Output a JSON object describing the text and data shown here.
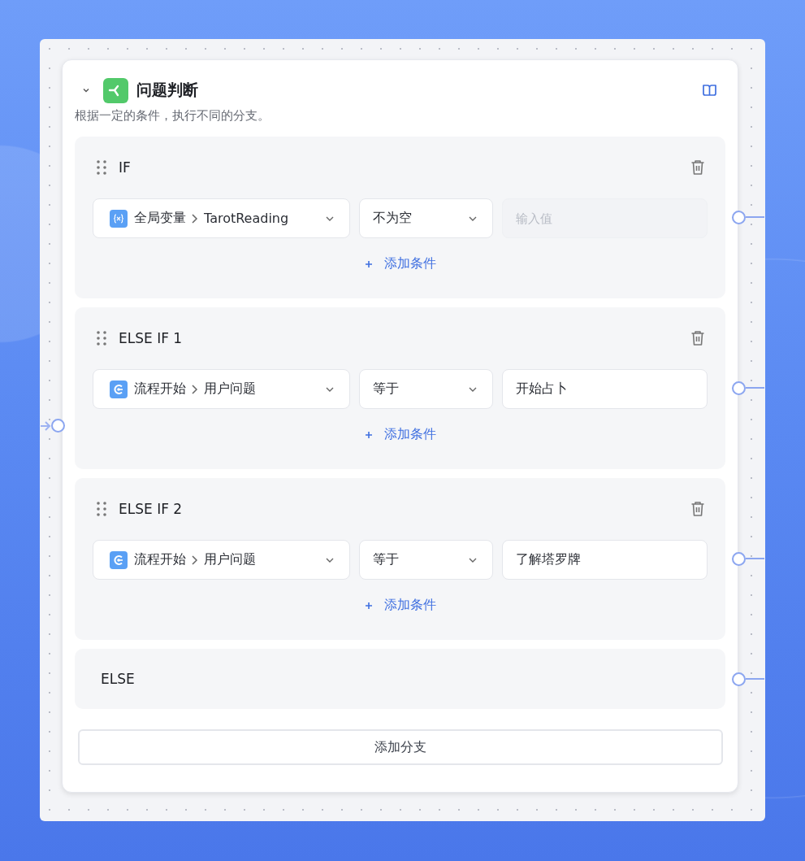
{
  "node": {
    "title": "问题判断",
    "expanded": true,
    "description": "根据一定的条件，执行不同的分支。"
  },
  "branches": [
    {
      "kind": "condition",
      "label": "IF",
      "conditions": [
        {
          "kind": "variable",
          "source": "全局变量",
          "field": "TarotReading",
          "operator": "不为空",
          "placeholder": "输入值"
        }
      ],
      "add_condition": "添加条件"
    },
    {
      "kind": "condition",
      "label": "ELSE IF 1",
      "conditions": [
        {
          "kind": "start",
          "source": "流程开始",
          "field": "用户问题",
          "operator": "等于",
          "value": "开始占卜"
        }
      ],
      "add_condition": "添加条件"
    },
    {
      "kind": "condition",
      "label": "ELSE IF 2",
      "conditions": [
        {
          "kind": "start",
          "source": "流程开始",
          "field": "用户问题",
          "operator": "等于",
          "value": "了解塔罗牌"
        }
      ],
      "add_condition": "添加条件"
    },
    {
      "kind": "else",
      "label": "ELSE"
    }
  ],
  "add_branch": "添加分支"
}
